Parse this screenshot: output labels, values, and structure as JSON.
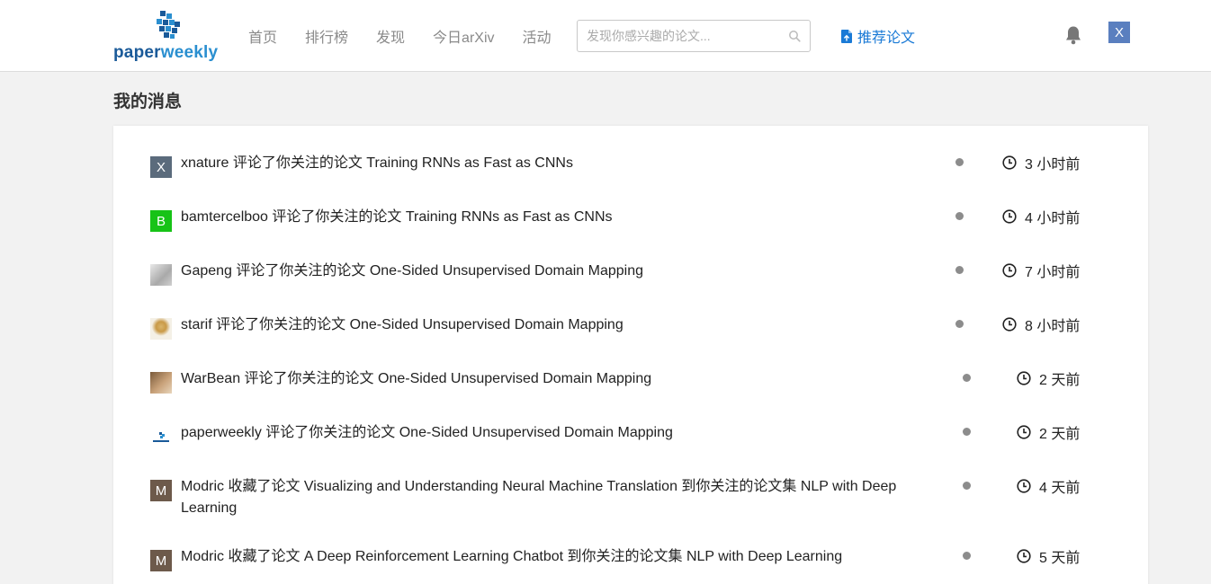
{
  "logo": {
    "text_part1": "paper",
    "text_part2": "weekly"
  },
  "nav": {
    "home": "首页",
    "ranking": "排行榜",
    "discover": "发现",
    "arxiv": "今日arXiv",
    "events": "活动"
  },
  "search": {
    "placeholder": "发现你感兴趣的论文...",
    "value": ""
  },
  "recommend": {
    "label": "推荐论文"
  },
  "user": {
    "avatar_letter": "X"
  },
  "page": {
    "title": "我的消息"
  },
  "messages": [
    {
      "avatar": "X",
      "text": "xnature 评论了你关注的论文 Training RNNs as Fast as CNNs",
      "time": "3 小时前"
    },
    {
      "avatar": "B",
      "text": "bamtercelboo 评论了你关注的论文 Training RNNs as Fast as CNNs",
      "time": "4 小时前"
    },
    {
      "avatar": "",
      "text": "Gapeng 评论了你关注的论文 One-Sided Unsupervised Domain Mapping",
      "time": "7 小时前"
    },
    {
      "avatar": "",
      "text": "starif 评论了你关注的论文 One-Sided Unsupervised Domain Mapping",
      "time": "8 小时前"
    },
    {
      "avatar": "",
      "text": "WarBean 评论了你关注的论文 One-Sided Unsupervised Domain Mapping",
      "time": "2 天前"
    },
    {
      "avatar": "",
      "text": "paperweekly 评论了你关注的论文 One-Sided Unsupervised Domain Mapping",
      "time": "2 天前"
    },
    {
      "avatar": "M",
      "text": "Modric 收藏了论文 Visualizing and Understanding Neural Machine Translation 到你关注的论文集 NLP with Deep Learning",
      "time": "4 天前"
    },
    {
      "avatar": "M",
      "text": "Modric 收藏了论文 A Deep Reinforcement Learning Chatbot 到你关注的论文集 NLP with Deep Learning",
      "time": "5 天前"
    }
  ],
  "colors": {
    "accent_blue": "#1a7ad6",
    "unread_dot": "#8c8c8c",
    "avatar_x": "#5b6b7c",
    "avatar_b": "#17c317",
    "avatar_m": "#6d5a4b"
  }
}
